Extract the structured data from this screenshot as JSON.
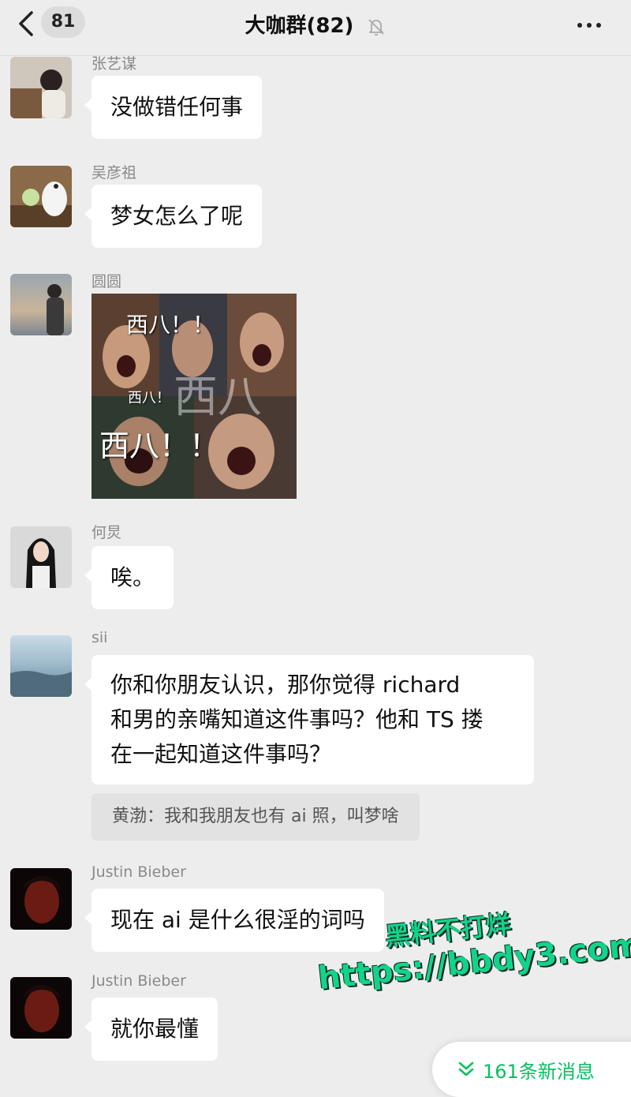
{
  "header": {
    "unread_count": "81",
    "title": "大咖群(82)",
    "icons": {
      "back": "chevron-left-icon",
      "mute": "bell-muted-icon",
      "more": "more-dots-icon"
    }
  },
  "messages": [
    {
      "sender": "张艺谋",
      "text": "没做错任何事"
    },
    {
      "sender": "吴彦祖",
      "text": "梦女怎么了呢"
    },
    {
      "sender": "圆圆",
      "image_captions": [
        "西八！！",
        "西八！",
        "西八",
        "西八！！"
      ]
    },
    {
      "sender": "何炅",
      "text": "唉。"
    },
    {
      "sender": "sii",
      "lines": [
        "你和你朋友认识，那你觉得 richard",
        "和男的亲嘴知道这件事吗？他和 TS 搂",
        "在一起知道这件事吗？"
      ],
      "quote": "黄渤：我和我朋友也有 ai 照，叫梦啥"
    },
    {
      "sender": "Justin Bieber",
      "text": "现在 ai 是什么很淫的词吗"
    },
    {
      "sender": "Justin Bieber",
      "text": "就你最懂"
    }
  ],
  "watermark": {
    "line1": "黑料不打烊",
    "line2": "https://bbdy3.com"
  },
  "new_messages": {
    "label": "161条新消息",
    "icon": "double-chevron-down-icon"
  },
  "colors": {
    "background": "#ededed",
    "bubble": "#ffffff",
    "accent": "#07c160",
    "watermark": "#12d38a"
  }
}
